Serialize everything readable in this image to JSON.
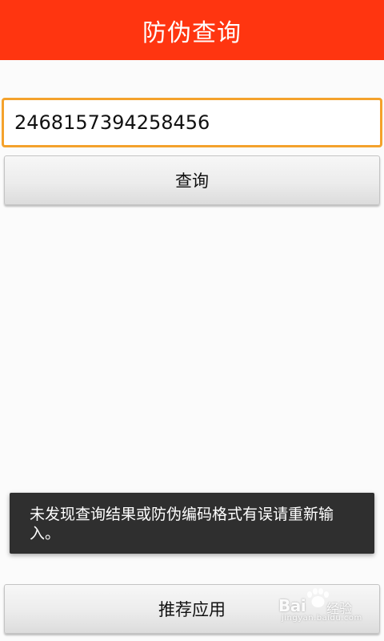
{
  "header": {
    "title": "防伪查询"
  },
  "query": {
    "input_value": "2468157394258456",
    "button_label": "查询"
  },
  "toast": {
    "message": "未发现查询结果或防伪编码格式有误请重新输入。"
  },
  "footer": {
    "recommend_label": "推荐应用"
  },
  "watermark": {
    "brand": "Bai",
    "word": "经验",
    "domain": "jingyan.baidu.com"
  },
  "colors": {
    "title_bar": "#ff3510",
    "input_focus_border": "#f4a22c",
    "toast_background": "#2f2f2f"
  }
}
